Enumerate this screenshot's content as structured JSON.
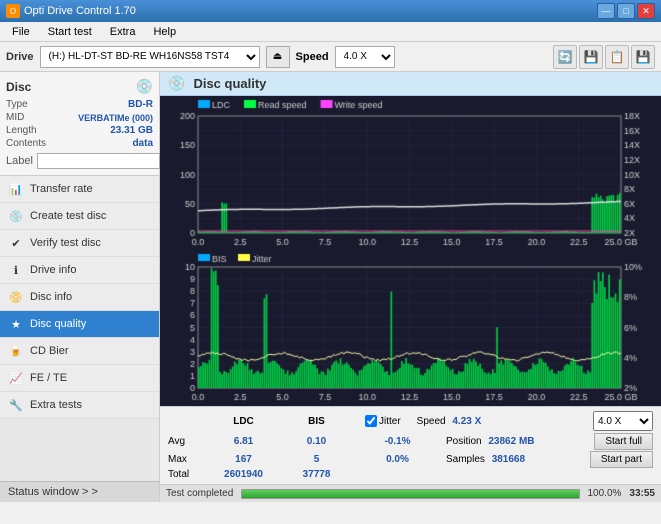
{
  "titlebar": {
    "title": "Opti Drive Control 1.70",
    "min_label": "—",
    "max_label": "□",
    "close_label": "✕"
  },
  "menu": {
    "items": [
      "File",
      "Start test",
      "Extra",
      "Help"
    ]
  },
  "drivebar": {
    "drive_label": "Drive",
    "drive_value": "(H:)  HL-DT-ST BD-RE  WH16NS58 TST4",
    "speed_label": "Speed",
    "speed_value": "4.0 X"
  },
  "disc": {
    "title": "Disc",
    "type_label": "Type",
    "type_value": "BD-R",
    "mid_label": "MID",
    "mid_value": "VERBATIMe (000)",
    "length_label": "Length",
    "length_value": "23.31 GB",
    "contents_label": "Contents",
    "contents_value": "data",
    "label_label": "Label",
    "label_value": ""
  },
  "nav": {
    "items": [
      {
        "id": "transfer-rate",
        "label": "Transfer rate",
        "icon": "📊"
      },
      {
        "id": "create-test-disc",
        "label": "Create test disc",
        "icon": "💿"
      },
      {
        "id": "verify-test-disc",
        "label": "Verify test disc",
        "icon": "✔"
      },
      {
        "id": "drive-info",
        "label": "Drive info",
        "icon": "ℹ"
      },
      {
        "id": "disc-info",
        "label": "Disc info",
        "icon": "📀"
      },
      {
        "id": "disc-quality",
        "label": "Disc quality",
        "icon": "★",
        "active": true
      },
      {
        "id": "cd-bier",
        "label": "CD Bier",
        "icon": "🍺"
      },
      {
        "id": "fe-te",
        "label": "FE / TE",
        "icon": "📈"
      },
      {
        "id": "extra-tests",
        "label": "Extra tests",
        "icon": "🔧"
      }
    ],
    "status_window": "Status window > >"
  },
  "content": {
    "title": "Disc quality",
    "chart1": {
      "legend": [
        "LDC",
        "Read speed",
        "Write speed"
      ],
      "y_max": 200,
      "y_labels": [
        "200",
        "150",
        "100",
        "50",
        "0"
      ],
      "y_right_labels": [
        "18X",
        "16X",
        "14X",
        "12X",
        "10X",
        "8X",
        "6X",
        "4X",
        "2X"
      ],
      "x_labels": [
        "0.0",
        "2.5",
        "5.0",
        "7.5",
        "10.0",
        "12.5",
        "15.0",
        "17.5",
        "20.0",
        "22.5",
        "25.0 GB"
      ]
    },
    "chart2": {
      "legend": [
        "BIS",
        "Jitter"
      ],
      "y_max": 10,
      "y_labels": [
        "10",
        "9",
        "8",
        "7",
        "6",
        "5",
        "4",
        "3",
        "2",
        "1"
      ],
      "y_right_labels": [
        "10%",
        "8%",
        "6%",
        "4%",
        "2%"
      ],
      "x_labels": [
        "0.0",
        "2.5",
        "5.0",
        "7.5",
        "10.0",
        "12.5",
        "15.0",
        "17.5",
        "20.0",
        "22.5",
        "25.0 GB"
      ]
    }
  },
  "stats": {
    "header": {
      "ldc": "LDC",
      "bis": "BIS",
      "jitter_label": "Jitter",
      "speed_label": "Speed",
      "speed_val": "4.23 X",
      "speed_select": "4.0 X"
    },
    "avg": {
      "label": "Avg",
      "ldc": "6.81",
      "bis": "0.10",
      "jitter": "-0.1%"
    },
    "max": {
      "label": "Max",
      "ldc": "167",
      "bis": "5",
      "jitter": "0.0%"
    },
    "total": {
      "label": "Total",
      "ldc": "2601940",
      "bis": "37778"
    },
    "position_label": "Position",
    "position_value": "23862 MB",
    "samples_label": "Samples",
    "samples_value": "381668",
    "start_full": "Start full",
    "start_part": "Start part"
  },
  "progress": {
    "pct": 100,
    "pct_label": "100.0%",
    "time": "33:55",
    "status": "Test completed"
  }
}
